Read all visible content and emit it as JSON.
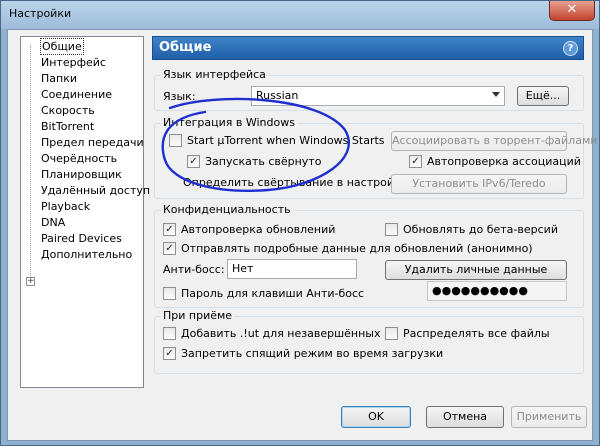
{
  "window": {
    "title": "Настройки",
    "close_symbol": "✕"
  },
  "sidebar": {
    "items": [
      {
        "label": "Общие"
      },
      {
        "label": "Интерфейс"
      },
      {
        "label": "Папки"
      },
      {
        "label": "Соединение"
      },
      {
        "label": "Скорость"
      },
      {
        "label": "BitTorrent"
      },
      {
        "label": "Предел передачи"
      },
      {
        "label": "Очерёдность"
      },
      {
        "label": "Планировщик"
      },
      {
        "label": "Удалённый доступ"
      },
      {
        "label": "Playback"
      },
      {
        "label": "DNA"
      },
      {
        "label": "Paired Devices"
      },
      {
        "label": "Дополнительно"
      }
    ],
    "expander_symbol": "+"
  },
  "panel": {
    "title": "Общие",
    "help_symbol": "?"
  },
  "language_group": {
    "title": "Язык интерфейса",
    "label": "Язык:",
    "selected": "Russian",
    "more_button": "Ещё..."
  },
  "windows_group": {
    "title": "Интеграция в Windows",
    "start_on_boot": {
      "label": "Start µTorrent when Windows Starts",
      "checked": false
    },
    "start_minimized": {
      "label": "Запускать свёрнуто",
      "checked": true
    },
    "minimize_note": "Определить свёртывание в настройках",
    "associate_button": "Ассоциировать в торрент-файлами",
    "auto_check_assoc": {
      "label": "Автопроверка ассоциаций",
      "checked": true
    },
    "ipv6_button": "Установить IPv6/Teredo"
  },
  "privacy_group": {
    "title": "Конфиденциальность",
    "auto_update": {
      "label": "Автопроверка обновлений",
      "checked": true
    },
    "beta_update": {
      "label": "Обновлять до бета-версий",
      "checked": false
    },
    "send_data": {
      "label": "Отправлять подробные данные для обновлений (анонимно)",
      "checked": true
    },
    "boss_label": "Анти-босс:",
    "boss_value": "Нет",
    "delete_button": "Удалить личные данные",
    "boss_password": {
      "label": "Пароль для клавиши Анти-босс",
      "checked": false
    },
    "password_value": "●●●●●●●●●●"
  },
  "download_group": {
    "title": "При приёме",
    "add_ut": {
      "label": "Добавить .!ut для незавершённых",
      "checked": false
    },
    "allocate": {
      "label": "Распределять все файлы",
      "checked": false
    },
    "no_sleep": {
      "label": "Запретить спящий режим во время загрузки",
      "checked": true
    }
  },
  "footer": {
    "ok": "OK",
    "cancel": "Отмена",
    "apply": "Применить"
  },
  "colors": {
    "annotation": "#1f2fd0",
    "header": "#2a6cb5"
  }
}
